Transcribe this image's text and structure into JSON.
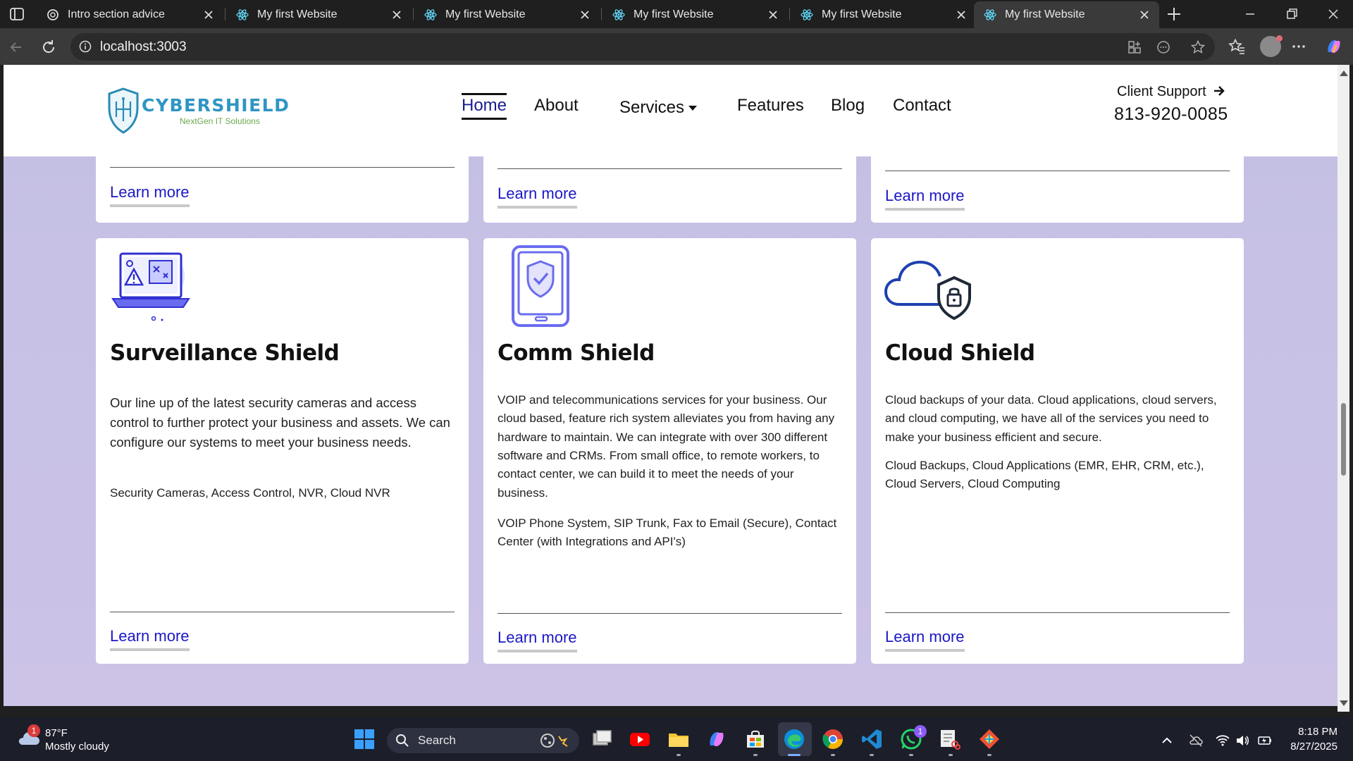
{
  "browser": {
    "tabs": [
      {
        "title": "Intro section advice",
        "active": false,
        "icon": "openai-icon"
      },
      {
        "title": "My first Website",
        "active": false,
        "icon": "react-icon"
      },
      {
        "title": "My first Website",
        "active": false,
        "icon": "react-icon"
      },
      {
        "title": "My first Website",
        "active": false,
        "icon": "react-icon"
      },
      {
        "title": "My first Website",
        "active": false,
        "icon": "react-icon"
      },
      {
        "title": "My first Website",
        "active": true,
        "icon": "react-icon"
      }
    ],
    "url": "localhost:3003"
  },
  "site": {
    "brand": "CYBERSHIELD",
    "tagline": "NextGen IT Solutions",
    "nav": {
      "home": "Home",
      "about": "About",
      "services": "Services",
      "features": "Features",
      "blog": "Blog",
      "contact": "Contact"
    },
    "support_label": "Client Support",
    "support_phone": "813-920-0085",
    "accent_color": "#1b18c6"
  },
  "cards_top": [
    {
      "link": "Learn more"
    },
    {
      "link": "Learn more"
    },
    {
      "link": "Learn more"
    }
  ],
  "cards": [
    {
      "icon": "surveillance-laptop-icon",
      "title": "Surveillance Shield",
      "description": "Our line up of the latest security cameras and access control to further protect your business and assets. We can configure our systems to meet your business needs.",
      "tags": "Security Cameras, Access Control, NVR, Cloud NVR",
      "link": "Learn more"
    },
    {
      "icon": "phone-shield-icon",
      "title": "Comm Shield",
      "description": "VOIP and telecommunications services for your business. Our cloud based, feature rich system alleviates you from having any hardware to maintain. We can integrate with over 300 different software and CRMs. From small office, to remote workers, to contact center, we can build it to meet the needs of your business.",
      "tags": "VOIP Phone System, SIP Trunk, Fax to Email (Secure), Contact Center (with Integrations and API's)",
      "link": "Learn more"
    },
    {
      "icon": "cloud-lock-icon",
      "title": "Cloud Shield",
      "description": "Cloud backups of your data. Cloud applications, cloud servers, and cloud computing, we have all of the services you need to make your business efficient and secure.",
      "tags": "Cloud Backups, Cloud Applications (EMR, EHR, CRM, etc.), Cloud Servers, Cloud Computing",
      "link": "Learn more"
    }
  ],
  "taskbar": {
    "weather_temp": "87°F",
    "weather_desc": "Mostly cloudy",
    "weather_badge": "1",
    "search_label": "Search",
    "whatsapp_badge": "1",
    "time": "8:18 PM",
    "date": "8/27/2025"
  }
}
